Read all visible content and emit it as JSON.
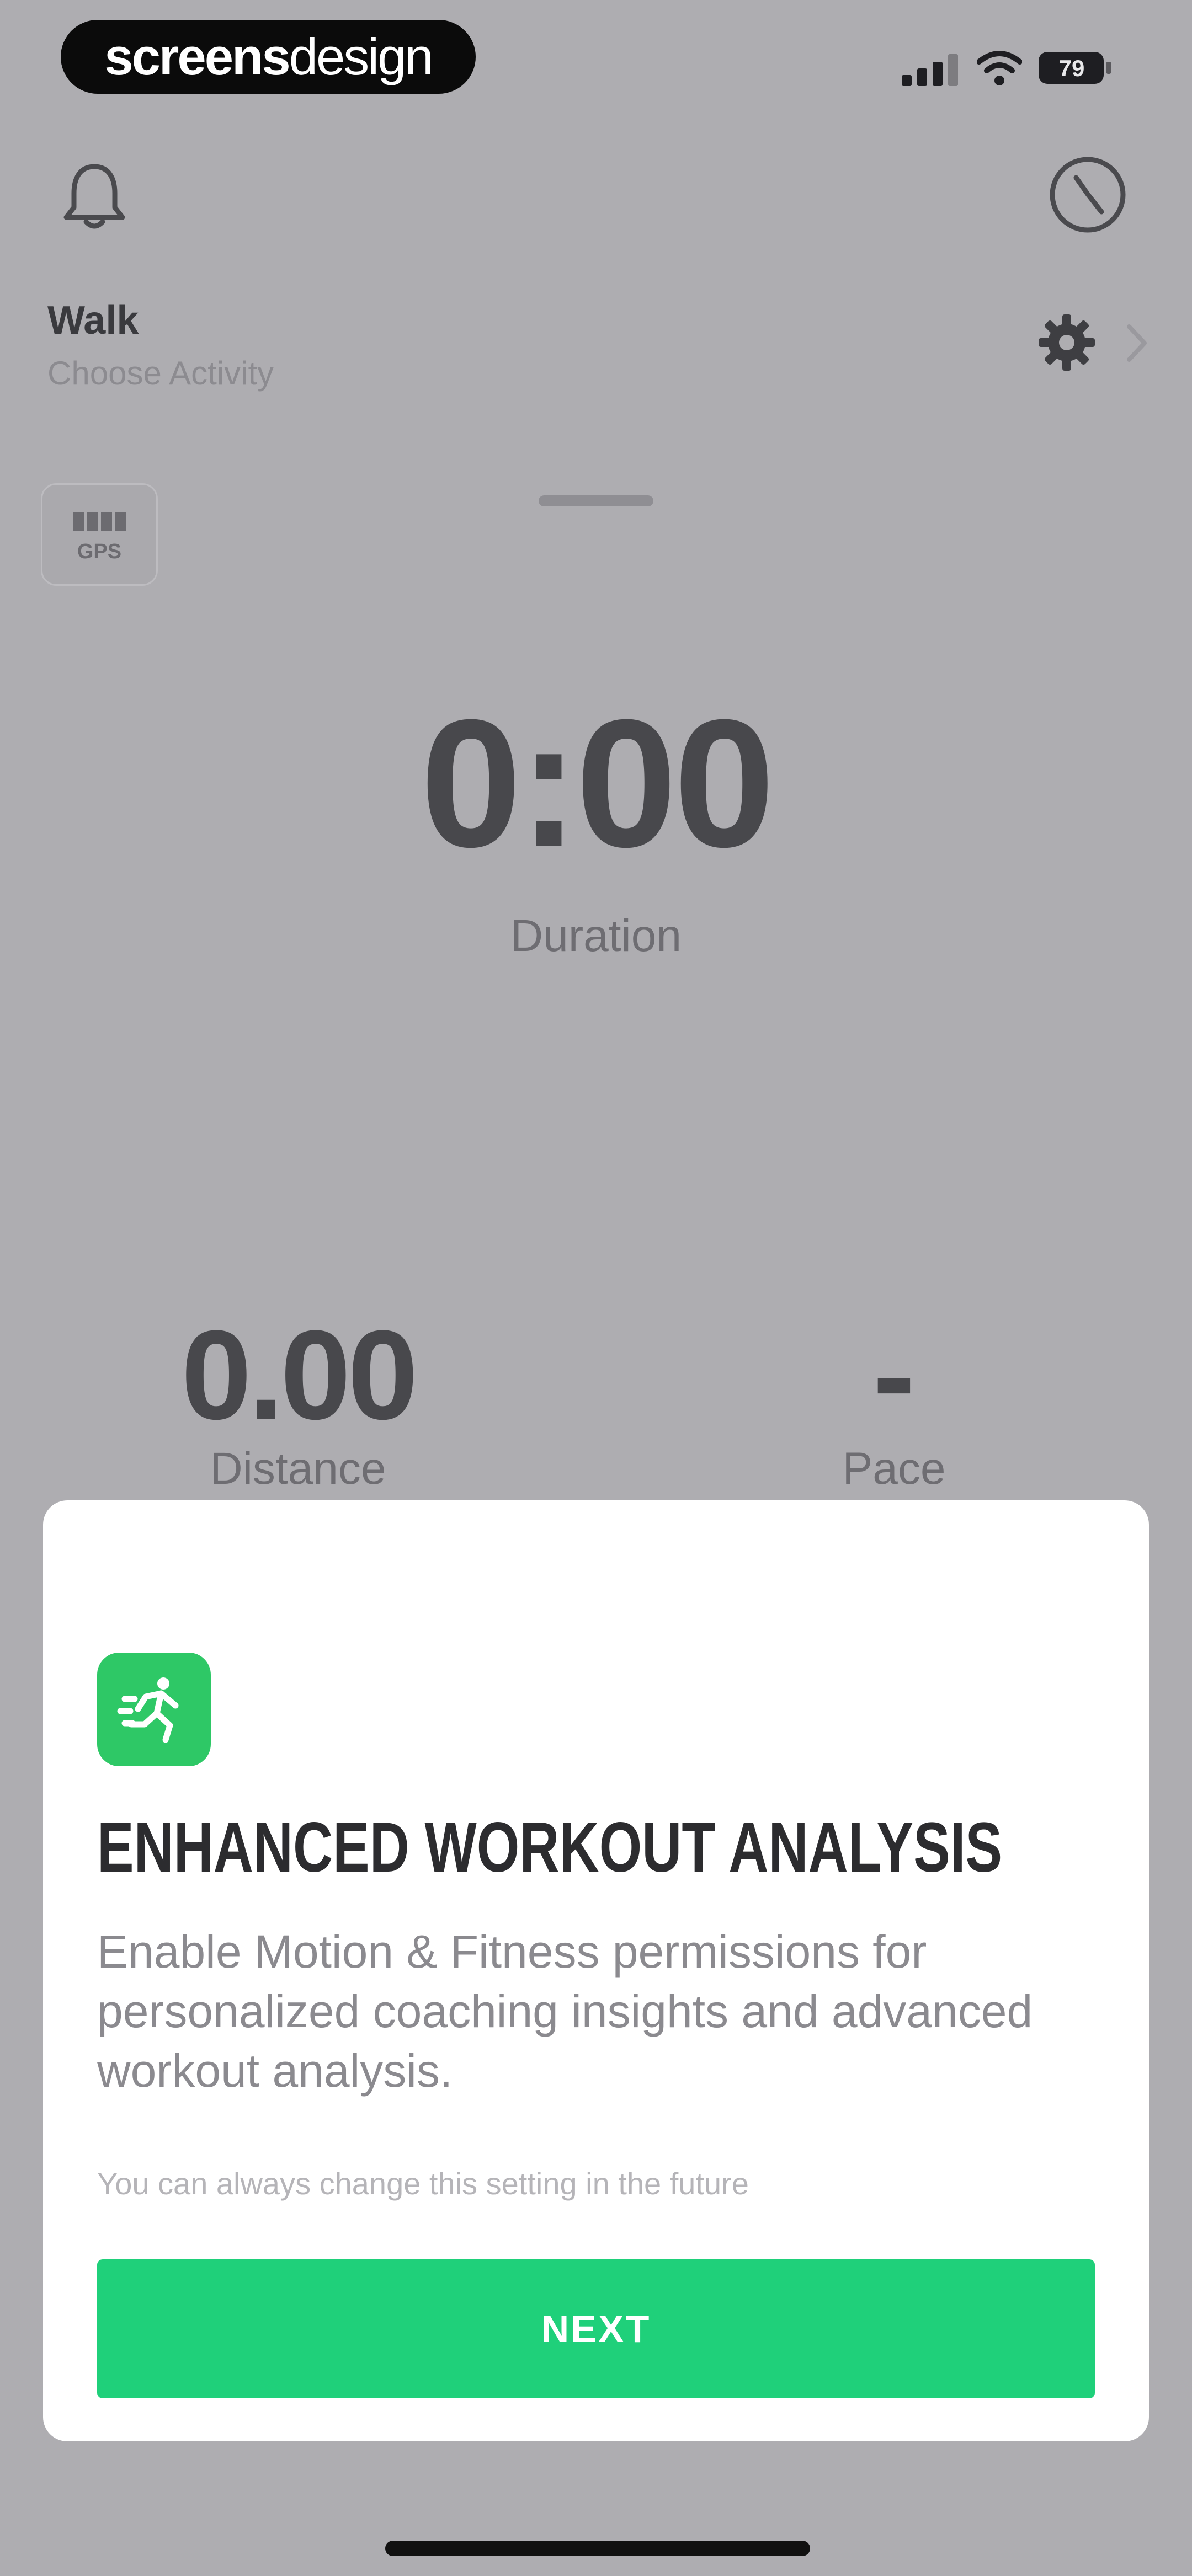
{
  "status_bar": {
    "brand_part1": "screens",
    "brand_part2": "design",
    "battery": "79"
  },
  "header": {
    "activity_title": "Walk",
    "activity_subtitle": "Choose Activity"
  },
  "gps": {
    "label": "GPS"
  },
  "metrics": {
    "duration_value": "0:00",
    "duration_label": "Duration",
    "distance_value": "0.00",
    "distance_label": "Distance",
    "pace_value": "-",
    "pace_label": "Pace"
  },
  "modal": {
    "title": "ENHANCED WORKOUT ANALYSIS",
    "body": "Enable Motion & Fitness permissions for personalized coaching insights and advanced workout analysis.",
    "note": "You can always change this setting in the future",
    "next_label": "NEXT"
  },
  "colors": {
    "accent_green": "#1fd07a",
    "icon_green": "#2ec866",
    "overlay_gray": "#aeadb1"
  },
  "icons": [
    "bell-icon",
    "clock-icon",
    "gear-icon",
    "chevron-right-icon",
    "signal-icon",
    "wifi-icon",
    "battery-icon",
    "running-icon"
  ]
}
